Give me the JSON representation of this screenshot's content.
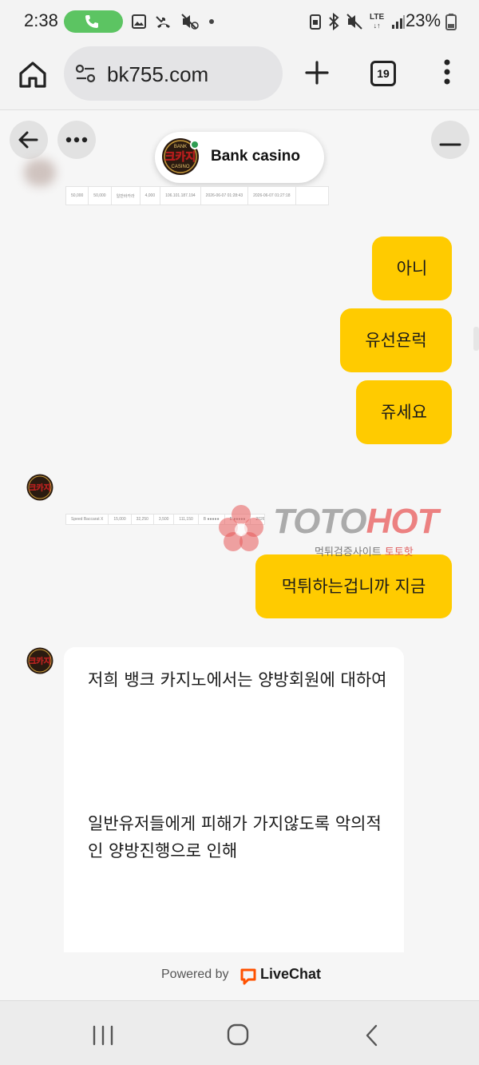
{
  "status_bar": {
    "time": "2:38",
    "battery": "23%",
    "network": "LTE",
    "icons": [
      "phone-icon",
      "gallery-icon",
      "missed-call-icon",
      "mute-icon",
      "dot-icon",
      "sim-icon",
      "bluetooth-icon",
      "vibrate-icon",
      "lte-icon",
      "signal-icon",
      "battery-icon"
    ],
    "call_color": "#5cc462"
  },
  "browser": {
    "url": "bk755.com",
    "tab_count": "19",
    "icons": [
      "home-icon",
      "tune-icon",
      "plus-icon",
      "tabs-icon",
      "kebab-menu-icon"
    ]
  },
  "chat": {
    "agent_name": "Bank casino",
    "online_color": "#2e9d52",
    "logo": {
      "top": "BANK",
      "main": "크카지",
      "bottom": "CASINO"
    },
    "header_icons": [
      "back-arrow-icon",
      "more-icon",
      "minimize-icon"
    ],
    "table_strip_1": [
      "50,000",
      "50,000",
      "일반바카라",
      "4,000",
      "106.101.187.194",
      "2026-06-07 01:28:43",
      "2026-06-07 01:27:18"
    ],
    "table_strip_2": [
      "Speed Baccarat X",
      "15,000",
      "32,250",
      "3,500",
      "111,150",
      "B ●●●●●",
      "B ●●●●●",
      "2026-06-07 01:33:32"
    ],
    "messages": [
      {
        "from": "user",
        "text": "아니"
      },
      {
        "from": "user",
        "text": "유선욘럭"
      },
      {
        "from": "user",
        "text": "쥬세요"
      },
      {
        "from": "user",
        "text": "먹튀하는겁니까 지금"
      }
    ],
    "agent_message": {
      "line1": "저희 뱅크 카지노에서는 양방회원에 대하여",
      "line2": "일반유저들에게 피해가 가지않도록 악의적인 양방진행으로 인해"
    },
    "bubble_color": "#ffcb00",
    "powered_by": "Powered by",
    "brand": "LiveChat",
    "brand_color": "#ff5100"
  },
  "watermark": {
    "word_a": "TOTO",
    "word_b": "HOT",
    "sub_a": "먹튀검증사이트",
    "sub_b": "토토핫"
  },
  "nav_bar": {
    "icons": [
      "recent-apps-icon",
      "home-circle-icon",
      "back-chevron-icon"
    ]
  }
}
